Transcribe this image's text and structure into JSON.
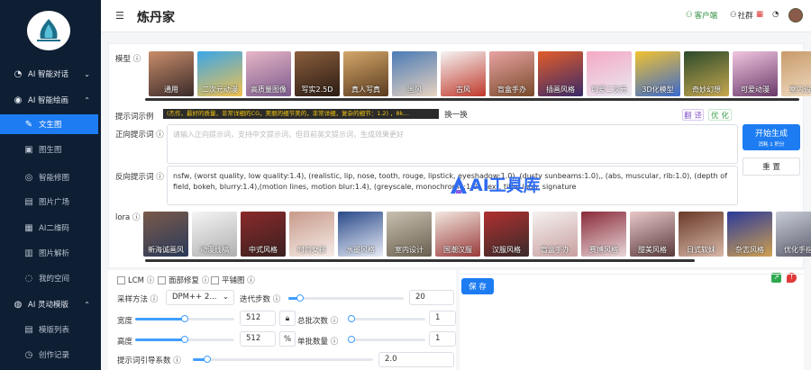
{
  "sidebar": {
    "groups": [
      {
        "label": "AI 智能对话",
        "icon": "chat-icon"
      },
      {
        "label": "AI 智能绘画",
        "icon": "palette-icon"
      },
      {
        "label": "AI 灵动模版",
        "icon": "template-icon"
      }
    ],
    "items": [
      {
        "label": "文生图",
        "icon": "brush-icon"
      },
      {
        "label": "图生图",
        "icon": "image-icon"
      },
      {
        "label": "智能修图",
        "icon": "retouch-icon"
      },
      {
        "label": "图片广场",
        "icon": "gallery-icon"
      },
      {
        "label": "AI二维码",
        "icon": "qrcode-icon"
      },
      {
        "label": "图片解析",
        "icon": "analyze-icon"
      },
      {
        "label": "我的空间",
        "icon": "space-icon"
      },
      {
        "label": "模版列表",
        "icon": "list-icon"
      },
      {
        "label": "创作记录",
        "icon": "record-icon"
      }
    ]
  },
  "header": {
    "title": "炼丹家",
    "client": "客户端",
    "community": "社群"
  },
  "model": {
    "label": "模型",
    "items": [
      {
        "name": "通用",
        "c": [
          "#c98d6a",
          "#3a2a2a"
        ]
      },
      {
        "name": "二次元动漫",
        "c": [
          "#3aa6e8",
          "#f2c14e"
        ]
      },
      {
        "name": "高质量图像",
        "c": [
          "#e7b6c7",
          "#7b5a8c"
        ]
      },
      {
        "name": "写实2.5D",
        "c": [
          "#8b5e3c",
          "#2b1c14"
        ]
      },
      {
        "name": "真人写真",
        "c": [
          "#d4a76a",
          "#5a3b1f"
        ]
      },
      {
        "name": "国风",
        "c": [
          "#4a7bb5",
          "#e8d2c0"
        ]
      },
      {
        "name": "古风",
        "c": [
          "#f5f5f5",
          "#c0392b"
        ]
      },
      {
        "name": "盲盒手办",
        "c": [
          "#e8a3a3",
          "#7a4a2a"
        ]
      },
      {
        "name": "插画风格",
        "c": [
          "#e25d2a",
          "#3b2a6a"
        ]
      },
      {
        "name": "可爱二次元",
        "c": [
          "#f5a9c4",
          "#e8e8f2"
        ]
      },
      {
        "name": "3D化模型",
        "c": [
          "#f2c230",
          "#3a6ad0"
        ]
      },
      {
        "name": "奇妙幻想",
        "c": [
          "#2b4a2a",
          "#c8a850"
        ]
      },
      {
        "name": "可爱动漫",
        "c": [
          "#f1c6e0",
          "#6a3a6a"
        ]
      },
      {
        "name": "室内设计",
        "c": [
          "#c89a6a",
          "#f2e0c8"
        ]
      }
    ]
  },
  "example": {
    "label": "提示词示例",
    "text": "(杰作，最好的质量，非常详细的CG，美丽的细节美的，非常详细，复杂的细节：1.2)  ，8k…",
    "swap": "换一换",
    "translate": "翻 译",
    "optimize": "优 化"
  },
  "positive": {
    "label": "正向提示词",
    "placeholder": "请输入正向提示词，支持中文提示词，但目前英文提示词，生成效果更好"
  },
  "negative": {
    "label": "反向提示词",
    "text": "nsfw, (worst quality, low quality:1.4), (realistic, lip, nose, tooth, rouge, lipstick, eyeshadow:1.0), (dusty sunbeams:1.0),, (abs, muscular, rib:1.0), (depth of field, bokeh, blurry:1.4),(motion lines, motion blur:1.4), (greyscale, monochrome:1.0), text, title, logo, signature"
  },
  "generate": {
    "label": "开始生成",
    "sub": "消耗 1 积分"
  },
  "reset": "重 置",
  "lora": {
    "label": "lora",
    "items": [
      {
        "name": "新海诚画风",
        "c": [
          "#7a5a4a",
          "#2a3a5a"
        ]
      },
      {
        "name": "动漫线稿",
        "c": [
          "#f5f5f5",
          "#b0b0b0"
        ]
      },
      {
        "name": "中式风格",
        "c": [
          "#8a2a2a",
          "#3a2020"
        ]
      },
      {
        "name": "时尚女孩",
        "c": [
          "#c89a8a",
          "#f5ece8"
        ]
      },
      {
        "name": "水墨风格",
        "c": [
          "#2a4a8a",
          "#e8ecf5"
        ]
      },
      {
        "name": "室内设计",
        "c": [
          "#c8c0b0",
          "#6a6050"
        ]
      },
      {
        "name": "国潮汉服",
        "c": [
          "#f2e8e0",
          "#9a3a3a"
        ]
      },
      {
        "name": "汉服风格",
        "c": [
          "#b03030",
          "#3a2a2a"
        ]
      },
      {
        "name": "盲盒手办",
        "c": [
          "#f5f2f0",
          "#c8a0a0"
        ]
      },
      {
        "name": "赛博风格",
        "c": [
          "#8a2a3a",
          "#e8d8d8"
        ]
      },
      {
        "name": "甜美风格",
        "c": [
          "#e8c8c8",
          "#5a3a3a"
        ]
      },
      {
        "name": "日式软妹",
        "c": [
          "#6a3a2a",
          "#d8b8a8"
        ]
      },
      {
        "name": "杂志风格",
        "c": [
          "#2a3a9a",
          "#d0a050"
        ]
      },
      {
        "name": "优化手指",
        "c": [
          "#c8ccd8",
          "#5a5a6a"
        ]
      }
    ]
  },
  "options": {
    "lcm": "LCM",
    "face": "面部修复",
    "tile": "平铺图"
  },
  "sampler": {
    "label": "采样方法",
    "value": "DPM++ 2..."
  },
  "steps": {
    "label": "迭代步数",
    "value": "20",
    "fraction": 0.1
  },
  "width": {
    "label": "宽度",
    "value": "512",
    "fraction": 0.5
  },
  "height": {
    "label": "高度",
    "value": "512",
    "fraction": 0.5
  },
  "batch": {
    "label": "总批次数",
    "value": "1"
  },
  "single": {
    "label": "单批数量",
    "value": "1"
  },
  "cfg": {
    "label": "提示词引导系数",
    "value": "2.0",
    "fraction": 0.08
  },
  "save": "保 存",
  "watermark": "AI工具库",
  "colors": {
    "accent": "#1d7cf2",
    "sidebar": "#0e1e33"
  }
}
